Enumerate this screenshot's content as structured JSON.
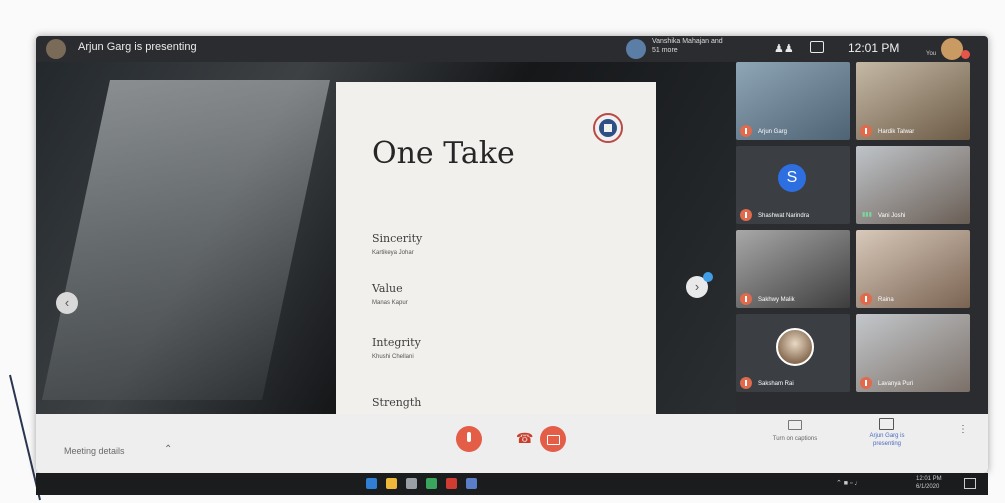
{
  "header": {
    "presenting_text": "Arjun Garg is presenting",
    "participants_text": "Vanshika Mahajan and 51 more",
    "clock": "12:01 PM",
    "you_label": "You"
  },
  "slide": {
    "title": "One Take",
    "items": [
      {
        "role": "Sincerity",
        "name": "Kartikeya Johar"
      },
      {
        "role": "Value",
        "name": "Manas Kapur"
      },
      {
        "role": "Integrity",
        "name": "Khushi Chellani"
      },
      {
        "role": "Strength",
        "name": ""
      }
    ]
  },
  "participants": [
    {
      "name": "Arjun Garg",
      "muted": true
    },
    {
      "name": "Hardik Talwar",
      "muted": true
    },
    {
      "name": "Shashwat Narindra",
      "muted": true,
      "initial": "S"
    },
    {
      "name": "Vani Joshi",
      "muted": false
    },
    {
      "name": "Sakhwy Malik",
      "muted": true
    },
    {
      "name": "Raina",
      "muted": true
    },
    {
      "name": "Saksham Rai",
      "muted": true
    },
    {
      "name": "Lavanya Puri",
      "muted": true
    }
  ],
  "bottombar": {
    "meeting_details": "Meeting details",
    "captions_label": "Turn on captions",
    "presenting_label": "Arjun Garg is presenting"
  },
  "taskbar": {
    "time": "12:01 PM",
    "date": "6/1/2020"
  },
  "colors": {
    "end_call_red": "#e35d47",
    "accent_blue": "#2d6fe0",
    "presenting_blue": "#4a6bbf"
  }
}
